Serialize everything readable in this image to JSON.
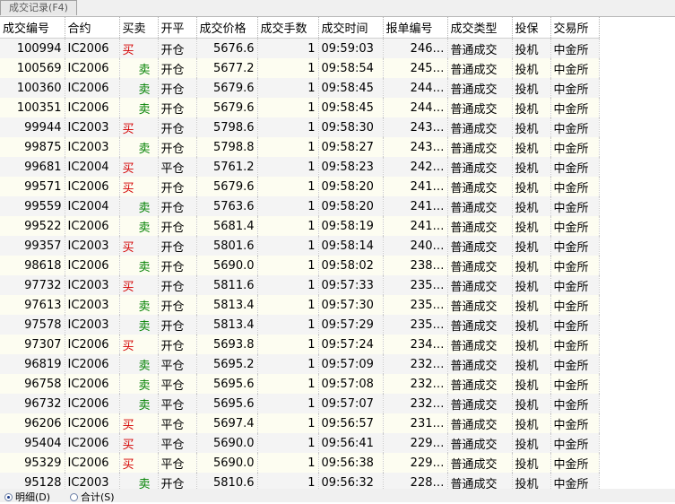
{
  "tab": {
    "label": "成交记录(F4)"
  },
  "columns": [
    "成交编号",
    "合约",
    "买卖",
    "开平",
    "成交价格",
    "成交手数",
    "成交时间",
    "报单编号",
    "成交类型",
    "投保",
    "交易所"
  ],
  "rows": [
    [
      "100994",
      "IC2006",
      "买",
      "开仓",
      "5676.6",
      "1",
      "09:59:03",
      "246…",
      "普通成交",
      "投机",
      "中金所"
    ],
    [
      "100569",
      "IC2006",
      "卖",
      "开仓",
      "5677.2",
      "1",
      "09:58:54",
      "245…",
      "普通成交",
      "投机",
      "中金所"
    ],
    [
      "100360",
      "IC2006",
      "卖",
      "开仓",
      "5679.6",
      "1",
      "09:58:45",
      "244…",
      "普通成交",
      "投机",
      "中金所"
    ],
    [
      "100351",
      "IC2006",
      "卖",
      "开仓",
      "5679.6",
      "1",
      "09:58:45",
      "244…",
      "普通成交",
      "投机",
      "中金所"
    ],
    [
      "99944",
      "IC2003",
      "买",
      "开仓",
      "5798.6",
      "1",
      "09:58:30",
      "243…",
      "普通成交",
      "投机",
      "中金所"
    ],
    [
      "99875",
      "IC2003",
      "卖",
      "开仓",
      "5798.8",
      "1",
      "09:58:27",
      "243…",
      "普通成交",
      "投机",
      "中金所"
    ],
    [
      "99681",
      "IC2004",
      "买",
      "平仓",
      "5761.2",
      "1",
      "09:58:23",
      "242…",
      "普通成交",
      "投机",
      "中金所"
    ],
    [
      "99571",
      "IC2006",
      "买",
      "开仓",
      "5679.6",
      "1",
      "09:58:20",
      "241…",
      "普通成交",
      "投机",
      "中金所"
    ],
    [
      "99559",
      "IC2004",
      "卖",
      "开仓",
      "5763.6",
      "1",
      "09:58:20",
      "241…",
      "普通成交",
      "投机",
      "中金所"
    ],
    [
      "99522",
      "IC2006",
      "卖",
      "开仓",
      "5681.4",
      "1",
      "09:58:19",
      "241…",
      "普通成交",
      "投机",
      "中金所"
    ],
    [
      "99357",
      "IC2003",
      "买",
      "开仓",
      "5801.6",
      "1",
      "09:58:14",
      "240…",
      "普通成交",
      "投机",
      "中金所"
    ],
    [
      "98618",
      "IC2006",
      "卖",
      "开仓",
      "5690.0",
      "1",
      "09:58:02",
      "238…",
      "普通成交",
      "投机",
      "中金所"
    ],
    [
      "97732",
      "IC2003",
      "买",
      "开仓",
      "5811.6",
      "1",
      "09:57:33",
      "235…",
      "普通成交",
      "投机",
      "中金所"
    ],
    [
      "97613",
      "IC2003",
      "卖",
      "开仓",
      "5813.4",
      "1",
      "09:57:30",
      "235…",
      "普通成交",
      "投机",
      "中金所"
    ],
    [
      "97578",
      "IC2003",
      "卖",
      "开仓",
      "5813.4",
      "1",
      "09:57:29",
      "235…",
      "普通成交",
      "投机",
      "中金所"
    ],
    [
      "97307",
      "IC2006",
      "买",
      "开仓",
      "5693.8",
      "1",
      "09:57:24",
      "234…",
      "普通成交",
      "投机",
      "中金所"
    ],
    [
      "96819",
      "IC2006",
      "卖",
      "平仓",
      "5695.2",
      "1",
      "09:57:09",
      "232…",
      "普通成交",
      "投机",
      "中金所"
    ],
    [
      "96758",
      "IC2006",
      "卖",
      "平仓",
      "5695.6",
      "1",
      "09:57:08",
      "232…",
      "普通成交",
      "投机",
      "中金所"
    ],
    [
      "96732",
      "IC2006",
      "卖",
      "平仓",
      "5695.6",
      "1",
      "09:57:07",
      "232…",
      "普通成交",
      "投机",
      "中金所"
    ],
    [
      "96206",
      "IC2006",
      "买",
      "平仓",
      "5697.4",
      "1",
      "09:56:57",
      "231…",
      "普通成交",
      "投机",
      "中金所"
    ],
    [
      "95404",
      "IC2006",
      "买",
      "平仓",
      "5690.0",
      "1",
      "09:56:41",
      "229…",
      "普通成交",
      "投机",
      "中金所"
    ],
    [
      "95329",
      "IC2006",
      "买",
      "平仓",
      "5690.0",
      "1",
      "09:56:38",
      "229…",
      "普通成交",
      "投机",
      "中金所"
    ],
    [
      "95128",
      "IC2003",
      "卖",
      "开仓",
      "5810.6",
      "1",
      "09:56:32",
      "228…",
      "普通成交",
      "投机",
      "中金所"
    ]
  ],
  "footer": {
    "detail_label": "明细(D)",
    "total_label": "合计(S)",
    "selected": "detail"
  },
  "colors": {
    "buy": "#d40000",
    "sell": "#008000"
  }
}
